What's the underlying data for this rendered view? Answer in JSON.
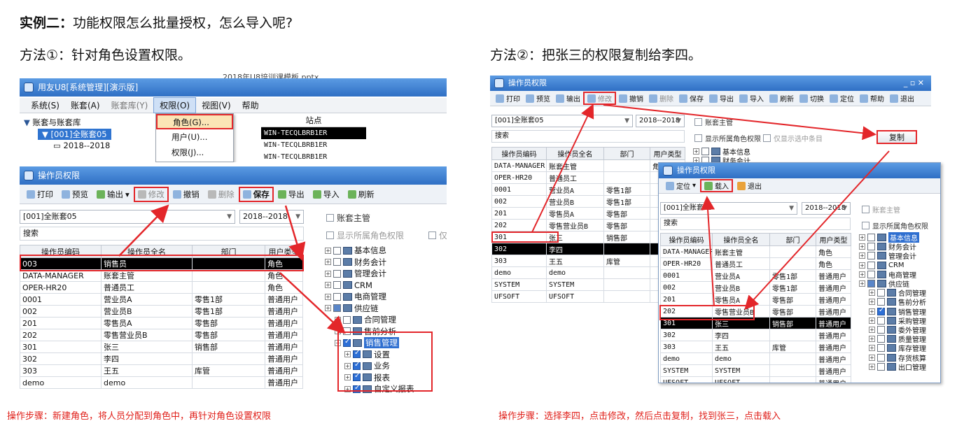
{
  "heading": {
    "label": "实例二：",
    "text": "功能权限怎么批量授权，怎么导入呢?"
  },
  "method1": {
    "title": "方法①：针对角色设置权限。",
    "caption": "操作步骤：新建角色，将人员分配到角色中，再针对角色设置权限"
  },
  "method2": {
    "title": "方法②：把张三的权限复制给李四。",
    "caption": "操作步骤：选择李四，点击修改，然后点击复制，找到张三，点击载入"
  },
  "colors": {
    "accent_red": "#e3262a",
    "title_blue": "#2f6fc4",
    "selection": "#000000"
  },
  "sysmgr": {
    "title": "用友U8[系统管理][演示版]",
    "overlay_text": "2018年U8培训课模板.pptx",
    "menu": [
      "系统(S)",
      "账套(A)",
      "账套库(Y)",
      "权限(O)",
      "视图(V)",
      "帮助"
    ],
    "tree_root": "账套与账套库",
    "tree_child": "[001]全账套05",
    "tree_year": "2018--2018",
    "site_header": "站点",
    "sites": [
      "WIN-TECQLBRB1ER",
      "WIN-TECQLBRB1ER",
      "WIN-TECQLBRB1ER"
    ],
    "dropdown": [
      "角色(G)...",
      "用户(U)...",
      "权限(J)..."
    ]
  },
  "perm1": {
    "title": "操作员权限",
    "toolbar": [
      "打印",
      "预览",
      "输出",
      "修改",
      "撤销",
      "删除",
      "保存",
      "导出",
      "导入",
      "刷新"
    ],
    "account": "[001]全账套05",
    "year": "2018--2018",
    "search": "搜索",
    "chk_master": "账套主管",
    "chk_role": "显示所属角色权限",
    "chk_only": "仅",
    "columns": [
      "操作员编码",
      "操作员全名",
      "部门",
      "用户类型"
    ],
    "rows": [
      [
        "003",
        "销售员",
        "",
        "角色"
      ],
      [
        "DATA-MANAGER",
        "账套主管",
        "",
        "角色"
      ],
      [
        "OPER-HR20",
        "普通员工",
        "",
        "角色"
      ],
      [
        "0001",
        "营业员A",
        "零售1部",
        "普通用户"
      ],
      [
        "002",
        "营业员B",
        "零售1部",
        "普通用户"
      ],
      [
        "201",
        "零售员A",
        "零售部",
        "普通用户"
      ],
      [
        "202",
        "零售营业员B",
        "零售部",
        "普通用户"
      ],
      [
        "301",
        "张三",
        "销售部",
        "普通用户"
      ],
      [
        "302",
        "李四",
        "",
        "普通用户"
      ],
      [
        "303",
        "王五",
        "库管",
        "普通用户"
      ],
      [
        "demo",
        "demo",
        "",
        "普通用户"
      ]
    ],
    "tree": [
      "基本信息",
      "财务会计",
      "管理会计",
      "CRM",
      "电商管理",
      "供应链",
      "合同管理",
      "售前分析",
      "销售管理",
      "设置",
      "业务",
      "报表",
      "自定义报表"
    ]
  },
  "perm2": {
    "title": "操作员权限",
    "toolbar": [
      "打印",
      "预览",
      "输出",
      "修改",
      "撤销",
      "删除",
      "保存",
      "导出",
      "导入",
      "刷新",
      "切换",
      "定位",
      "帮助",
      "退出"
    ],
    "account": "[001]全账套05",
    "year": "2018--2018",
    "search": "搜索",
    "chk_master": "账套主管",
    "chk_role": "显示所属角色权限",
    "chk_only": "仅显示选中条目",
    "copy_button": "复制",
    "columns": [
      "操作员编码",
      "操作员全名",
      "部门",
      "用户类型"
    ],
    "rows": [
      [
        "DATA-MANAGER",
        "账套主管",
        "",
        "角色"
      ],
      [
        "OPER-HR20",
        "普通员工",
        "",
        ""
      ],
      [
        "0001",
        "营业员A",
        "零售1部",
        ""
      ],
      [
        "002",
        "营业员B",
        "零售1部",
        ""
      ],
      [
        "201",
        "零售员A",
        "零售部",
        ""
      ],
      [
        "202",
        "零售营业员B",
        "零售部",
        ""
      ],
      [
        "301",
        "张三",
        "销售部",
        ""
      ],
      [
        "302",
        "李四",
        "",
        ""
      ],
      [
        "303",
        "王五",
        "库管",
        ""
      ],
      [
        "demo",
        "demo",
        "",
        ""
      ],
      [
        "SYSTEM",
        "SYSTEM",
        "",
        ""
      ],
      [
        "UFSOFT",
        "UFSOFT",
        "",
        ""
      ]
    ],
    "tree": [
      "基本信息",
      "财务会计"
    ]
  },
  "perm3": {
    "title": "操作员权限",
    "toolbar": [
      "定位",
      "载入",
      "退出"
    ],
    "account": "[001]全账套05",
    "year": "2018--2018",
    "search": "搜索",
    "chk_master": "账套主管",
    "chk_role": "显示所属角色权限",
    "columns": [
      "操作员编码",
      "操作员全名",
      "部门",
      "用户类型"
    ],
    "rows": [
      [
        "DATA-MANAGER",
        "账套主管",
        "",
        "角色"
      ],
      [
        "OPER-HR20",
        "普通员工",
        "",
        "角色"
      ],
      [
        "0001",
        "营业员A",
        "零售1部",
        "普通用户"
      ],
      [
        "002",
        "营业员B",
        "零售1部",
        "普通用户"
      ],
      [
        "201",
        "零售员A",
        "零售部",
        "普通用户"
      ],
      [
        "202",
        "零售营业员B",
        "零售部",
        "普通用户"
      ],
      [
        "301",
        "张三",
        "销售部",
        "普通用户"
      ],
      [
        "302",
        "李四",
        "",
        "普通用户"
      ],
      [
        "303",
        "王五",
        "库管",
        "普通用户"
      ],
      [
        "demo",
        "demo",
        "",
        "普通用户"
      ],
      [
        "SYSTEM",
        "SYSTEM",
        "",
        "普通用户"
      ],
      [
        "UFSOFT",
        "UFSOFT",
        "",
        "普通用户"
      ]
    ],
    "tree": [
      "基本信息",
      "财务会计",
      "管理会计",
      "CRM",
      "电商管理",
      "供应链",
      "合同管理",
      "售前分析",
      "销售管理",
      "采购管理",
      "委外管理",
      "质量管理",
      "库存管理",
      "存货核算",
      "出口管理"
    ]
  }
}
